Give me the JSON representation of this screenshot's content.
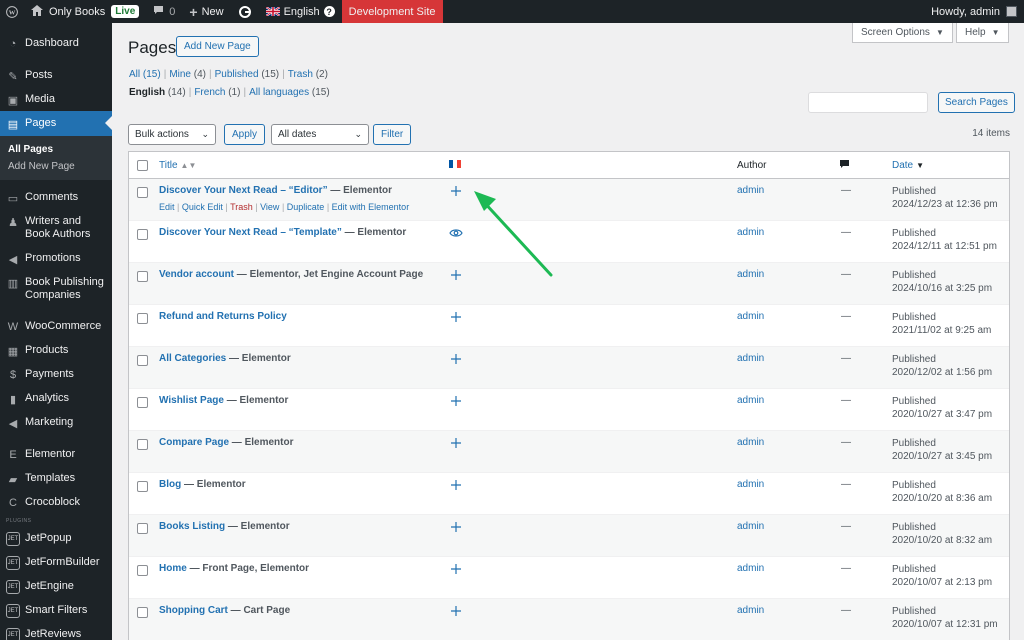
{
  "adminbar": {
    "site_name": "Only Books",
    "live_label": "Live",
    "comments_count": "0",
    "new_label": "New",
    "language": "English",
    "help_glyph": "?",
    "dev_site": "Development Site",
    "howdy": "Howdy, admin"
  },
  "sidebar": {
    "items": [
      {
        "label": "Dashboard",
        "icon": "dashboard-icon"
      },
      {
        "label": "Posts",
        "icon": "pin-icon"
      },
      {
        "label": "Media",
        "icon": "media-icon"
      },
      {
        "label": "Pages",
        "icon": "pages-icon"
      },
      {
        "label": "Comments",
        "icon": "comment-icon"
      },
      {
        "label": "Writers and Book Authors",
        "icon": "users-icon"
      },
      {
        "label": "Promotions",
        "icon": "megaphone-icon"
      },
      {
        "label": "Book Publishing Companies",
        "icon": "book-icon"
      },
      {
        "label": "WooCommerce",
        "icon": "woo-icon"
      },
      {
        "label": "Products",
        "icon": "archive-icon"
      },
      {
        "label": "Payments",
        "icon": "dollar-icon"
      },
      {
        "label": "Analytics",
        "icon": "chart-icon"
      },
      {
        "label": "Marketing",
        "icon": "megaphone-icon"
      },
      {
        "label": "Elementor",
        "icon": "elementor-icon"
      },
      {
        "label": "Templates",
        "icon": "folder-icon"
      },
      {
        "label": "Crocoblock",
        "icon": "croco-icon"
      },
      {
        "label": "JetPopup",
        "icon": "jet-icon"
      },
      {
        "label": "JetFormBuilder",
        "icon": "jet-icon"
      },
      {
        "label": "JetEngine",
        "icon": "jet-icon"
      },
      {
        "label": "Smart Filters",
        "icon": "jet-icon"
      },
      {
        "label": "JetReviews",
        "icon": "jet-icon"
      }
    ],
    "submenu": [
      "All Pages",
      "Add New Page"
    ],
    "plugins_label": "PLUGINS",
    "jet_badge": "JET"
  },
  "main": {
    "title": "Pages",
    "add_new": "Add New Page",
    "screen_options": "Screen Options",
    "help": "Help",
    "views": [
      {
        "label": "All",
        "count": "(15)"
      },
      {
        "label": "Mine",
        "count": "(4)"
      },
      {
        "label": "Published",
        "count": "(15)"
      },
      {
        "label": "Trash",
        "count": "(2)"
      }
    ],
    "langs": [
      {
        "label": "English",
        "count": "(14)"
      },
      {
        "label": "French",
        "count": "(1)"
      },
      {
        "label": "All languages",
        "count": "(15)"
      }
    ],
    "search_button": "Search Pages",
    "bulk_actions": "Bulk actions",
    "apply": "Apply",
    "all_dates": "All dates",
    "filter": "Filter",
    "items_count": "14 items"
  },
  "table": {
    "headers": {
      "title": "Title",
      "author": "Author",
      "date": "Date"
    },
    "row_actions": [
      "Edit",
      "Quick Edit",
      "Trash",
      "View",
      "Duplicate",
      "Edit with Elementor"
    ],
    "rows": [
      {
        "title": "Discover Your Next Read – “Editor”",
        "state": " — Elementor",
        "icon": "plus",
        "author": "admin",
        "comments": "—",
        "status": "Published",
        "date": "2024/12/23 at 12:36 pm"
      },
      {
        "title": "Discover Your Next Read – “Template”",
        "state": " — Elementor",
        "icon": "eye",
        "author": "admin",
        "comments": "—",
        "status": "Published",
        "date": "2024/12/11 at 12:51 pm"
      },
      {
        "title": "Vendor account",
        "state": " — Elementor, Jet Engine Account Page",
        "icon": "plus",
        "author": "admin",
        "comments": "—",
        "status": "Published",
        "date": "2024/10/16 at 3:25 pm"
      },
      {
        "title": "Refund and Returns Policy",
        "state": "",
        "icon": "plus",
        "author": "admin",
        "comments": "—",
        "status": "Published",
        "date": "2021/11/02 at 9:25 am"
      },
      {
        "title": "All Categories",
        "state": " — Elementor",
        "icon": "plus",
        "author": "admin",
        "comments": "—",
        "status": "Published",
        "date": "2020/12/02 at 1:56 pm"
      },
      {
        "title": "Wishlist Page",
        "state": " — Elementor",
        "icon": "plus",
        "author": "admin",
        "comments": "—",
        "status": "Published",
        "date": "2020/10/27 at 3:47 pm"
      },
      {
        "title": "Compare Page",
        "state": " — Elementor",
        "icon": "plus",
        "author": "admin",
        "comments": "—",
        "status": "Published",
        "date": "2020/10/27 at 3:45 pm"
      },
      {
        "title": "Blog",
        "state": " — Elementor",
        "icon": "plus",
        "author": "admin",
        "comments": "—",
        "status": "Published",
        "date": "2020/10/20 at 8:36 am"
      },
      {
        "title": "Books Listing",
        "state": " — Elementor",
        "icon": "plus",
        "author": "admin",
        "comments": "—",
        "status": "Published",
        "date": "2020/10/20 at 8:32 am"
      },
      {
        "title": "Home",
        "state": " — Front Page, Elementor",
        "icon": "plus",
        "author": "admin",
        "comments": "—",
        "status": "Published",
        "date": "2020/10/07 at 2:13 pm"
      },
      {
        "title": "Shopping Cart",
        "state": " — Cart Page",
        "icon": "plus",
        "author": "admin",
        "comments": "—",
        "status": "Published",
        "date": "2020/10/07 at 12:31 pm"
      }
    ]
  },
  "colors": {
    "adminbar_bg": "#1d2327",
    "accent": "#2271b1",
    "dev_site": "#d63638",
    "arrow": "#1db954"
  }
}
